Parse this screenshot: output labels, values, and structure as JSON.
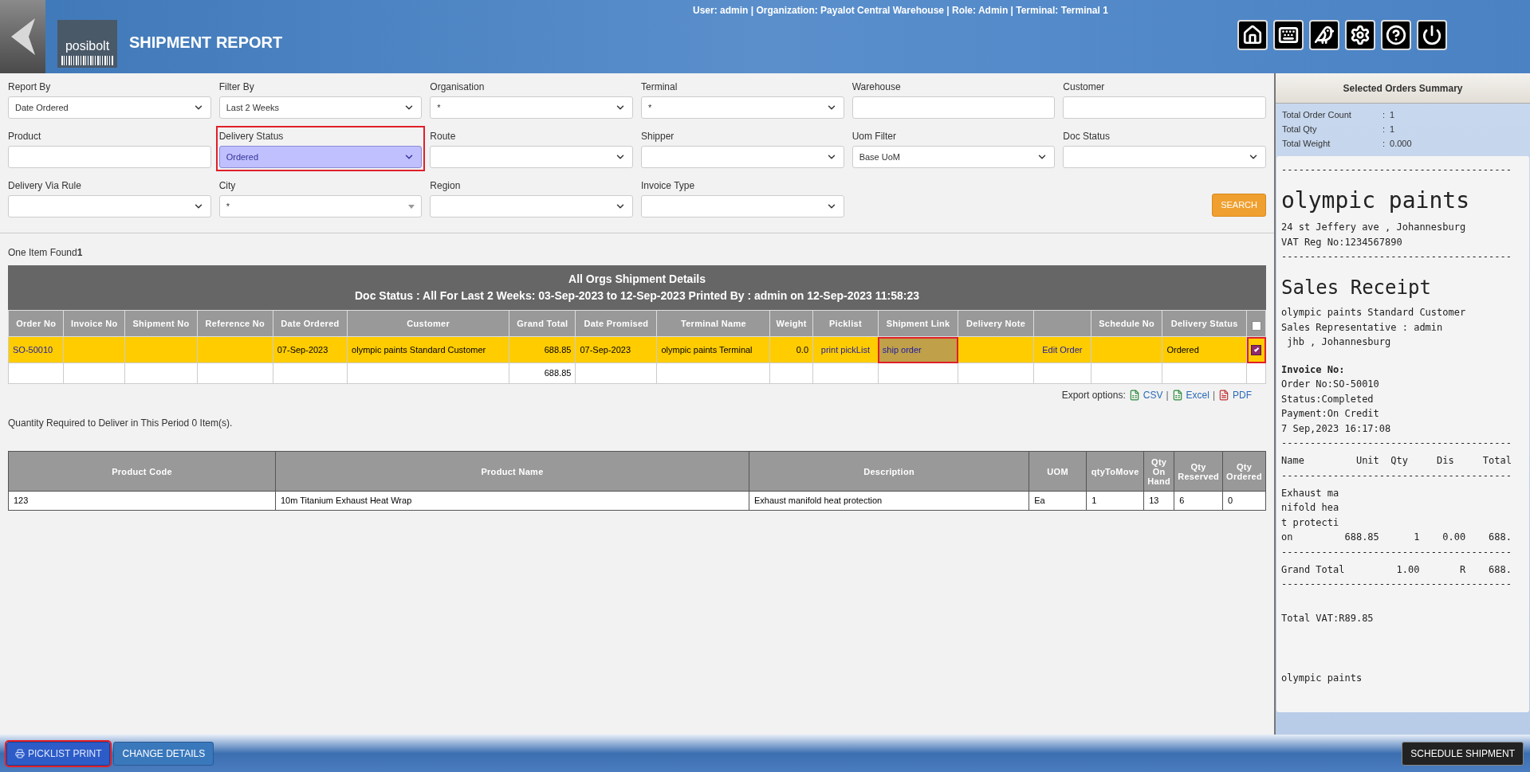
{
  "header": {
    "user_info": "User: admin | Organization: Payalot Central Warehouse | Role: Admin | Terminal: Terminal 1",
    "logo_text": "posibolt",
    "title": "SHIPMENT REPORT",
    "icons": [
      {
        "kind": "home"
      },
      {
        "kind": "keyboard"
      },
      {
        "kind": "bird"
      },
      {
        "kind": "settings"
      },
      {
        "kind": "help"
      },
      {
        "kind": "power"
      }
    ]
  },
  "filters": [
    {
      "label": "Report By",
      "kind": "select",
      "value": "Date Ordered",
      "highlighted": false
    },
    {
      "label": "Filter By",
      "kind": "select",
      "value": "Last 2 Weeks",
      "highlighted": false
    },
    {
      "label": "Organisation",
      "kind": "select",
      "value": "*",
      "highlighted": false
    },
    {
      "label": "Terminal",
      "kind": "select",
      "value": "*",
      "highlighted": false
    },
    {
      "label": "Warehouse",
      "kind": "input",
      "highlighted": false
    },
    {
      "label": "Customer",
      "kind": "input",
      "highlighted": false
    },
    {
      "label": "Product",
      "kind": "input",
      "highlighted": false
    },
    {
      "label": "Delivery Status",
      "kind": "select",
      "value": "Ordered",
      "highlighted": true
    },
    {
      "label": "Route",
      "kind": "select",
      "highlighted": false
    },
    {
      "label": "Shipper",
      "kind": "select",
      "highlighted": false
    },
    {
      "label": "Uom Filter",
      "kind": "select",
      "value": "Base UoM",
      "highlighted": false
    },
    {
      "label": "Doc Status",
      "kind": "select",
      "highlighted": false
    },
    {
      "label": "Delivery Via Rule",
      "kind": "select",
      "highlighted": false
    },
    {
      "label": "City",
      "kind": "combo",
      "value": "*",
      "highlighted": false
    },
    {
      "label": "Region",
      "kind": "select",
      "highlighted": false
    },
    {
      "label": "Invoice Type",
      "kind": "select",
      "highlighted": false
    }
  ],
  "search_button": "SEARCH",
  "result_count": "One Item Found**1**",
  "report": {
    "title": "All Orgs Shipment Details",
    "subtitle": "Doc Status : All For Last 2 Weeks: 03-Sep-2023 to 12-Sep-2023 Printed By : admin on 12-Sep-2023 11:58:23",
    "columns": [
      {
        "label": "Order No"
      },
      {
        "label": "Invoice No"
      },
      {
        "label": "Shipment No"
      },
      {
        "label": "Reference No"
      },
      {
        "label": "Date Ordered"
      },
      {
        "label": "Customer"
      },
      {
        "label": "Grand Total"
      },
      {
        "label": "Date Promised"
      },
      {
        "label": "Terminal Name"
      },
      {
        "label": "Weight"
      },
      {
        "label": "Picklist"
      },
      {
        "label": "Shipment Link"
      },
      {
        "label": "Delivery Note"
      },
      {
        "kind": "blank"
      },
      {
        "label": "Schedule No"
      },
      {
        "label": "Delivery Status"
      }
    ],
    "select_all_checked": false,
    "rows": [
      {
        "checked": true,
        "highlighted_check": true,
        "cells": [
          {
            "text": "SO-50010",
            "kind": "link"
          },
          {
            "kind": "text"
          },
          {
            "kind": "text"
          },
          {
            "kind": "text"
          },
          {
            "text": "07-Sep-2023",
            "kind": "text"
          },
          {
            "text": "olympic paints Standard Customer",
            "kind": "text"
          },
          {
            "text": "688.85",
            "kind": "number"
          },
          {
            "text": "07-Sep-2023",
            "kind": "text"
          },
          {
            "text": "olympic paints Terminal",
            "kind": "text"
          },
          {
            "text": "0.0",
            "kind": "number"
          },
          {
            "text": "print pickList",
            "kind": "link"
          },
          {
            "text": "ship order",
            "kind": "highlight_link"
          },
          {
            "kind": "text"
          },
          {
            "text": "Edit Order",
            "kind": "link"
          },
          {
            "kind": "text"
          },
          {
            "text": "Ordered",
            "kind": "text"
          }
        ]
      }
    ],
    "total_row": {
      "grand_total": "688.85"
    }
  },
  "export": {
    "label": "Export options:",
    "separator": "|",
    "links": [
      {
        "text": "CSV",
        "kind": "csv"
      },
      {
        "text": "Excel",
        "kind": "excel"
      },
      {
        "text": "PDF",
        "kind": "pdf"
      }
    ]
  },
  "quantity_note": "Quantity Required to Deliver in This Period 0 Item(s).",
  "products": {
    "columns": [
      "Product Code",
      "Product Name",
      "Description",
      "UOM",
      "qtyToMove",
      "Qty On Hand",
      "Qty Reserved",
      "Qty Ordered"
    ],
    "rows": [
      [
        "123",
        "10m Titanium Exhaust Heat Wrap",
        "Exhaust manifold heat protection",
        "Ea",
        "1",
        "13",
        "6",
        "0"
      ]
    ]
  },
  "summary": {
    "title": "Selected Orders Summary",
    "separator": ":",
    "stats": [
      {
        "label": "Total Order Count",
        "value": "1"
      },
      {
        "label": "Total Qty",
        "value": "1"
      },
      {
        "label": "Total Weight",
        "value": "0.000"
      }
    ],
    "receipt": [
      {
        "kind": "rule",
        "text": "----------------------------------------"
      },
      {
        "kind": "shop",
        "text": "olympic paints"
      },
      {
        "kind": "line",
        "text": "24 st Jeffery ave , Johannesburg"
      },
      {
        "kind": "line",
        "text": "VAT Reg No:1234567890"
      },
      {
        "kind": "rule",
        "text": "----------------------------------------"
      },
      {
        "kind": "heading",
        "text": "Sales Receipt"
      },
      {
        "kind": "line",
        "text": "olympic paints Standard Customer"
      },
      {
        "kind": "line",
        "text": "Sales Representative : admin"
      },
      {
        "kind": "line",
        "text": " jhb , Johannesburg"
      },
      {
        "kind": "bold",
        "text": "Invoice No:"
      },
      {
        "kind": "line",
        "text": "Order No:SO-50010"
      },
      {
        "kind": "line",
        "text": "Status:Completed"
      },
      {
        "kind": "line",
        "text": "Payment:On Credit"
      },
      {
        "kind": "line",
        "text": "7 Sep,2023 16:17:08"
      },
      {
        "kind": "rule",
        "text": "----------------------------------------"
      },
      {
        "kind": "line",
        "text": "Name         Unit  Qty     Dis     Total"
      },
      {
        "kind": "rule",
        "text": "----------------------------------------"
      },
      {
        "kind": "line",
        "text": "Exhaust ma"
      },
      {
        "kind": "line",
        "text": "nifold hea"
      },
      {
        "kind": "line",
        "text": "t protecti"
      },
      {
        "kind": "line",
        "text": "on         688.85      1    0.00    688."
      },
      {
        "kind": "rule",
        "text": "----------------------------------------"
      },
      {
        "kind": "line",
        "text": "Grand Total         1.00       R    688."
      },
      {
        "kind": "rule",
        "text": "----------------------------------------"
      },
      {
        "kind": "spaced",
        "text": "Total VAT:R89.85"
      },
      {
        "kind": "footer",
        "text": "olympic paints"
      }
    ]
  },
  "bottom_buttons": [
    {
      "text": "PICKLIST PRINT",
      "kind": "print",
      "highlighted": true
    },
    {
      "text": "CHANGE DETAILS",
      "kind": "plain",
      "highlighted": false
    },
    {
      "text": "SCHEDULE SHIPMENT",
      "kind": "dark",
      "highlighted": false
    }
  ]
}
